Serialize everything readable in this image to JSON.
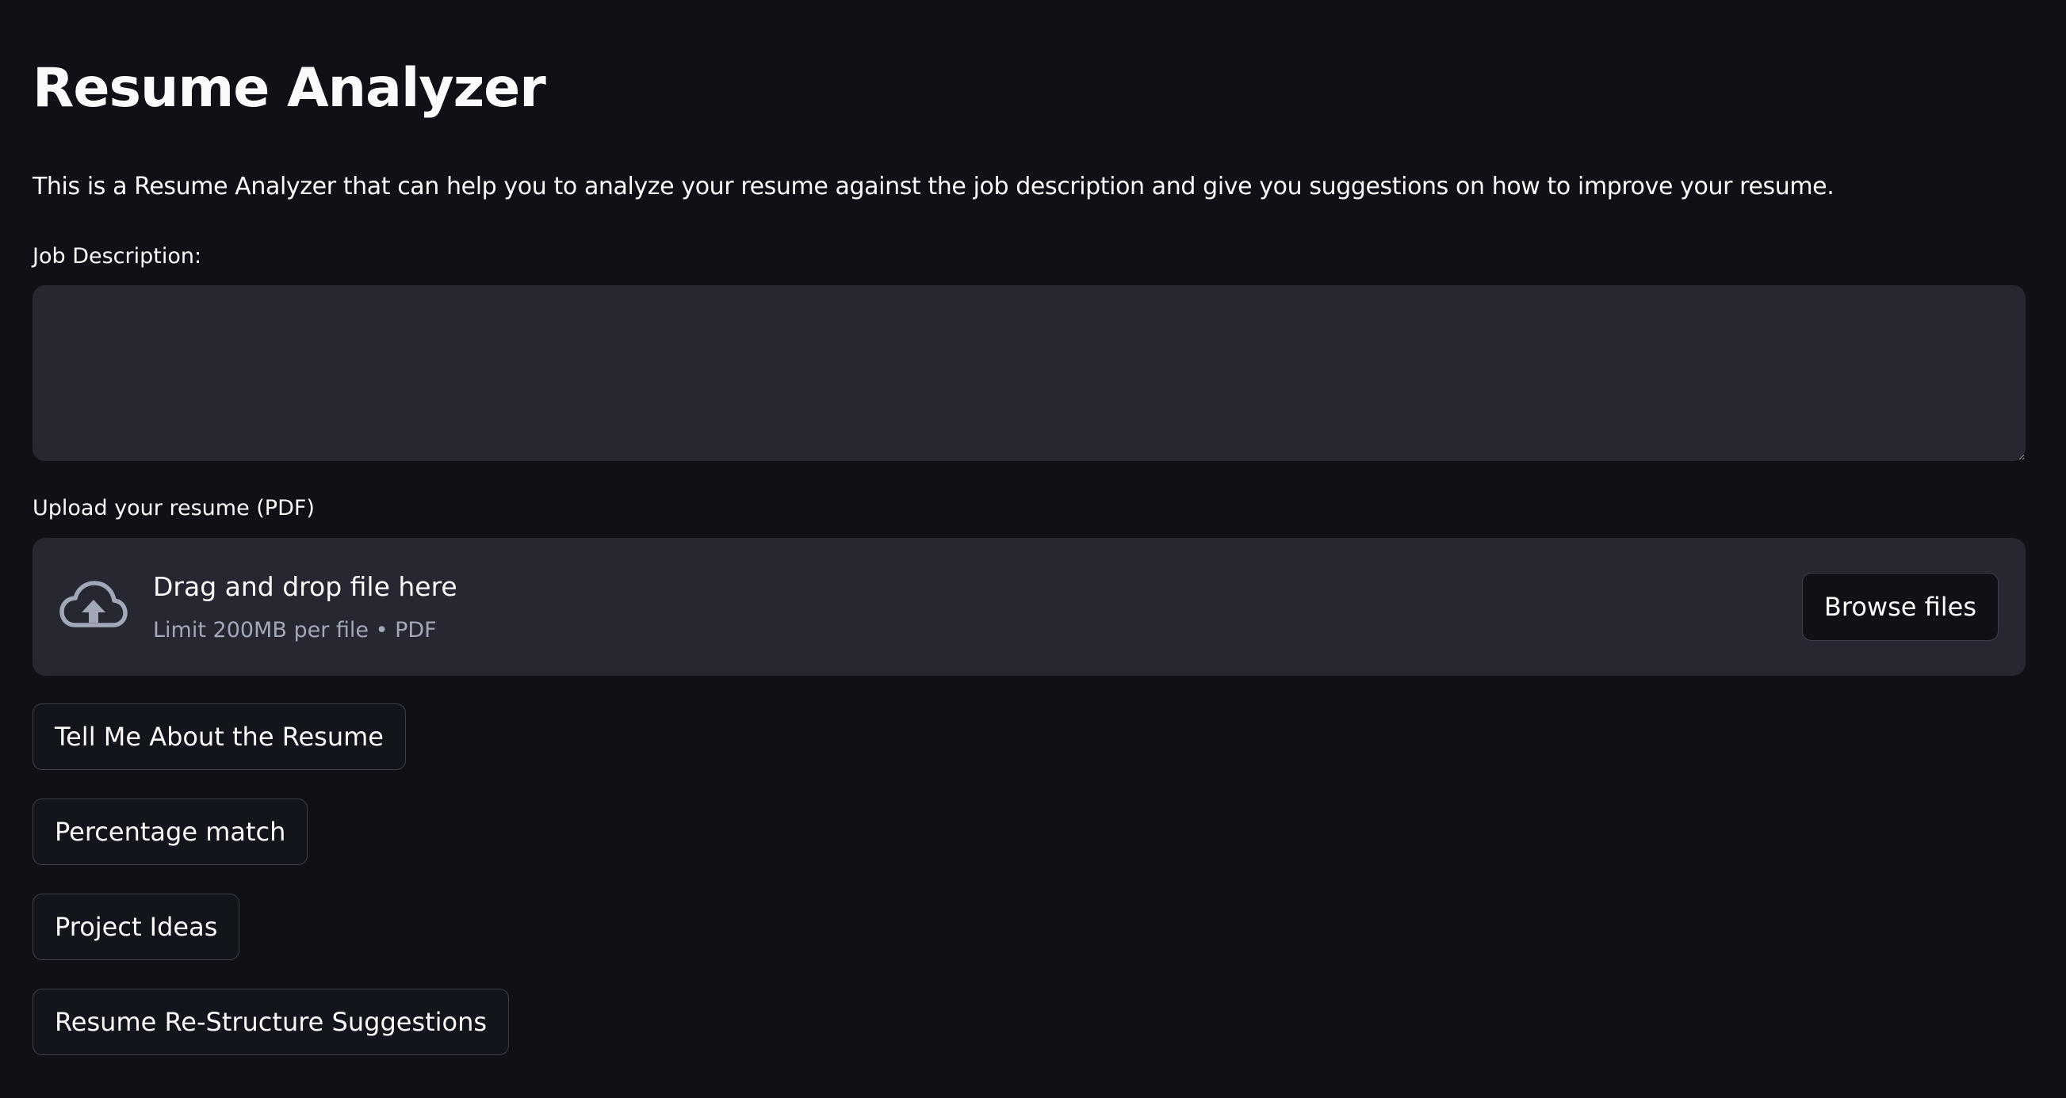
{
  "app": {
    "title": "Resume Analyzer",
    "description": "This is a Resume Analyzer that can help you to analyze your resume against the job description and give you suggestions on how to improve your resume."
  },
  "job_description": {
    "label": "Job Description:",
    "value": "",
    "placeholder": ""
  },
  "uploader": {
    "label": "Upload your resume (PDF)",
    "icon": "cloud-upload-icon",
    "dropzone_text": "Drag and drop file here",
    "limit_text": "Limit 200MB per file • PDF",
    "browse_label": "Browse files"
  },
  "actions": [
    {
      "label": "Tell Me About the Resume"
    },
    {
      "label": "Percentage match"
    },
    {
      "label": "Project Ideas"
    },
    {
      "label": "Resume Re-Structure Suggestions"
    }
  ],
  "colors": {
    "background": "#0f1117",
    "surface": "#262730",
    "text": "#fafafa",
    "muted_text": "#a3a8b8",
    "button_border": "#3d404c"
  }
}
